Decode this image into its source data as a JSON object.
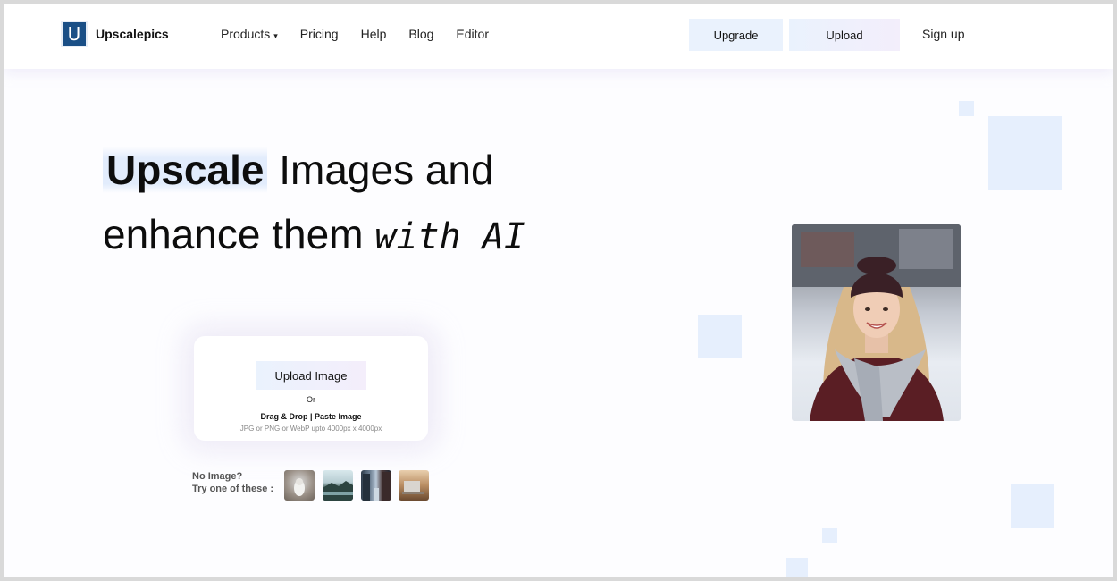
{
  "header": {
    "logo_letter": "U",
    "brand": "Upscalepics",
    "nav": [
      {
        "label": "Products",
        "caret": "▾"
      },
      {
        "label": "Pricing"
      },
      {
        "label": "Help"
      },
      {
        "label": "Blog"
      },
      {
        "label": "Editor"
      }
    ],
    "upgrade_label": "Upgrade",
    "upload_label": "Upload",
    "signup_label": "Sign up"
  },
  "hero": {
    "highlight": "Upscale",
    "line1_rest": " Images and",
    "line2_main": "enhance them ",
    "line2_script": "with AI"
  },
  "upload_card": {
    "button_label": "Upload Image",
    "or_text": "Or",
    "drag_drop": "Drag & Drop | Paste Image",
    "formats": "JPG or PNG or WebP upto 4000px x 4000px"
  },
  "samples": {
    "line1": "No Image?",
    "line2": "Try one of these :"
  },
  "colors": {
    "accent_light": "#e6effd",
    "logo_bg": "#1a4f86"
  }
}
